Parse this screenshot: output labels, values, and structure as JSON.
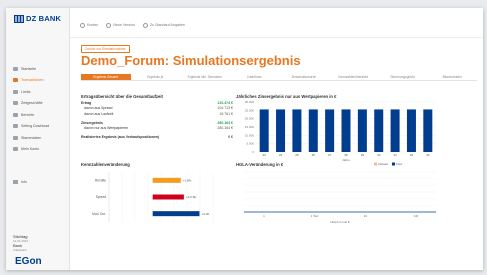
{
  "brand": {
    "name": "DZ BANK",
    "footer": "EGon",
    "accent": "#e87722",
    "blue": "#003d8f"
  },
  "sidebar": {
    "items": [
      {
        "label": "Startseite",
        "icon": "home-icon",
        "active": false
      },
      {
        "label": "Transaktionen",
        "icon": "list-icon",
        "active": true
      },
      {
        "label": "Limits",
        "icon": "limit-icon",
        "active": false
      },
      {
        "label": "Zeitgeschäfte",
        "icon": "table-icon",
        "active": false
      },
      {
        "label": "Berichte",
        "icon": "report-icon",
        "active": false
      },
      {
        "label": "Setting Download",
        "icon": "download-icon",
        "active": false
      },
      {
        "label": "Stammdaten",
        "icon": "data-icon",
        "active": false
      },
      {
        "label": "Mein Konto",
        "icon": "user-icon",
        "active": false
      }
    ],
    "extra": "Info",
    "user": {
      "name": "Stichtag",
      "sub": "13.01.2022",
      "name2": "Bank",
      "sub2": "Volksbank"
    }
  },
  "topbar": {
    "items": [
      "Konten",
      "Neue Version",
      "Zu Standard Angaben"
    ]
  },
  "back_button": "Zurück zur Simulationsliste",
  "title": "Demo_Forum: Simulationsergebnis",
  "tabs": [
    "Ergebnis Gesamt",
    "Ergebnis je",
    "Ergebnis inkl. Szenarien",
    "Cashflows",
    "Zinsstrukturkurve",
    "Kennzahlenübersicht",
    "Steuerungsgröße",
    "Bilanzstruktur"
  ],
  "summary": {
    "title": "Ertragsübersicht über die Gesamtlaufzeit",
    "rows": [
      {
        "label": "Ertrag",
        "value": "120.474 €",
        "style": "bold green"
      },
      {
        "label": "davon aus Spread",
        "value": "104.713 €",
        "style": "indent"
      },
      {
        "label": "davon aus Laufzeit",
        "value": "15.761 €",
        "style": "indent"
      },
      {
        "label": "",
        "value": "",
        "style": "gap"
      },
      {
        "label": "Zinsergebnis",
        "value": "280.164 €",
        "style": "bold green"
      },
      {
        "label": "davon nur aus Wertpapieren",
        "value": "280.164 €",
        "style": "indent"
      },
      {
        "label": "",
        "value": "",
        "style": "gap"
      },
      {
        "label": "Realisiertes Ergebnis (aus Verkaufspositionen)",
        "value": "0 €",
        "style": "bold"
      }
    ]
  },
  "chart_data": [
    {
      "type": "bar",
      "title": "Jährliches Zinsergebnis nur aus Wertpapieren in €",
      "categories": [
        "23",
        "24",
        "25",
        "26",
        "27",
        "28",
        "29",
        "30",
        "31",
        "32",
        "33"
      ],
      "series": [
        {
          "name": "Verkauf",
          "values": [
            0,
            0,
            0,
            0,
            0,
            0,
            0,
            0,
            0,
            0,
            0
          ],
          "color": "#f0c090"
        },
        {
          "name": "Kauf",
          "values": [
            29800,
            29800,
            29800,
            29800,
            29800,
            29800,
            29800,
            29800,
            29800,
            29800,
            29800
          ],
          "color": "#003d8f"
        }
      ],
      "ylim": [
        0,
        35000
      ],
      "yticks": [
        "30.000",
        "25.000",
        "20.000",
        "15.000",
        "10.000",
        "5.000",
        "0"
      ],
      "xlabel": "Jahre"
    },
    {
      "type": "bar",
      "orientation": "horizontal",
      "title": "Kennzahlenveränderung",
      "categories": [
        "Rendite",
        "Spread",
        "Mod. Dur."
      ],
      "values": [
        1.8,
        2.0,
        3.0
      ],
      "labels": [
        "+1,8%",
        "+3,6 Bp",
        "+0,00"
      ],
      "colors": [
        "#f39c1f",
        "#d0021b",
        "#003d8f"
      ]
    },
    {
      "type": "line",
      "title": "HGLA-Veränderung in €",
      "x": [
        0,
        1,
        2,
        3,
        4,
        5,
        6,
        7,
        8,
        9,
        10,
        11,
        12
      ],
      "y": [
        0,
        0,
        0,
        0,
        0,
        0,
        0,
        0,
        0,
        0,
        0,
        0,
        0
      ],
      "xticks": [
        "1",
        "1 Tsd.",
        "10",
        "1M"
      ],
      "xlabel": "HGLA in mio €"
    }
  ]
}
